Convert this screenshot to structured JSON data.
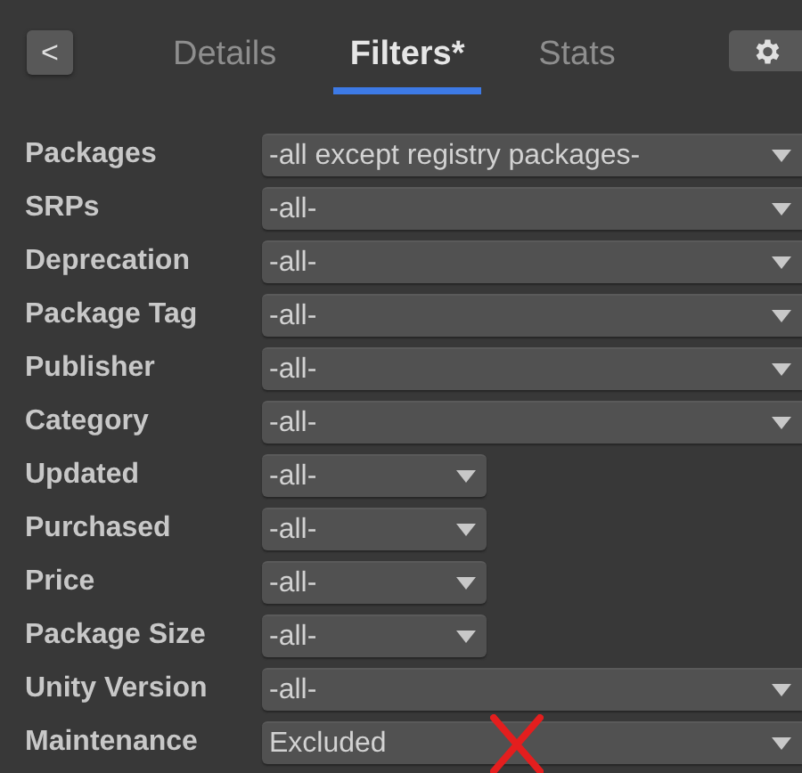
{
  "header": {
    "back_button": "<",
    "tabs": [
      {
        "label": "Details",
        "selected": false
      },
      {
        "label": "Filters*",
        "selected": true
      },
      {
        "label": "Stats",
        "selected": false
      }
    ]
  },
  "filters": [
    {
      "label": "Packages",
      "value": "-all except registry packages-",
      "kind": "wide",
      "crossed": false
    },
    {
      "label": "SRPs",
      "value": "-all-",
      "kind": "wide",
      "crossed": false
    },
    {
      "label": "Deprecation",
      "value": "-all-",
      "kind": "wide",
      "crossed": false
    },
    {
      "label": "Package Tag",
      "value": "-all-",
      "kind": "wide",
      "crossed": false
    },
    {
      "label": "Publisher",
      "value": "-all-",
      "kind": "wide",
      "crossed": false
    },
    {
      "label": "Category",
      "value": "-all-",
      "kind": "wide",
      "crossed": false
    },
    {
      "label": "Updated",
      "value": "-all-",
      "kind": "narrow",
      "crossed": false
    },
    {
      "label": "Purchased",
      "value": "-all-",
      "kind": "narrow",
      "crossed": false
    },
    {
      "label": "Price",
      "value": "-all-",
      "kind": "narrow",
      "crossed": false
    },
    {
      "label": "Package Size",
      "value": "-all-",
      "kind": "narrow",
      "crossed": false
    },
    {
      "label": "Unity Version",
      "value": "-all-",
      "kind": "wide",
      "crossed": false
    },
    {
      "label": "Maintenance",
      "value": "Excluded",
      "kind": "wide",
      "crossed": true
    }
  ]
}
